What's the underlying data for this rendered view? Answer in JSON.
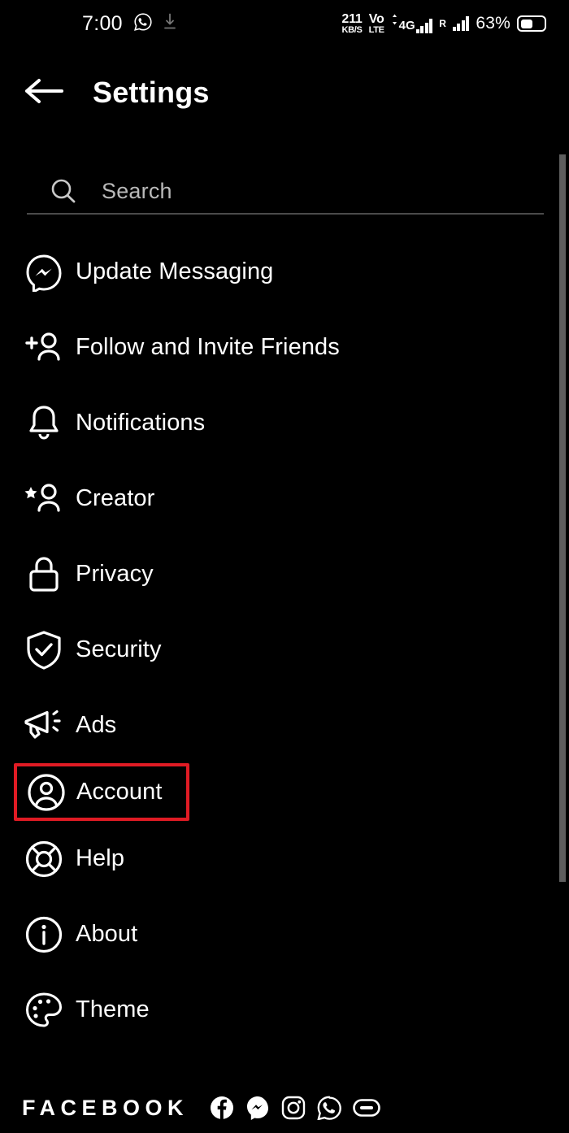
{
  "status_bar": {
    "time": "7:00",
    "whatsapp_icon": "whatsapp-icon",
    "download_icon": "download-icon",
    "net_speed_value": "211",
    "net_speed_unit": "KB/S",
    "volte_top": "Vo",
    "volte_bottom": "LTE",
    "network_type": "4G",
    "roaming_label": "R",
    "battery_percent": "63%"
  },
  "header": {
    "back_icon": "back-arrow-icon",
    "title": "Settings"
  },
  "search": {
    "icon": "search-icon",
    "placeholder": "Search",
    "value": ""
  },
  "settings": {
    "items": [
      {
        "icon": "messenger-icon",
        "label": "Update Messaging",
        "highlighted": false
      },
      {
        "icon": "add-person-icon",
        "label": "Follow and Invite Friends",
        "highlighted": false
      },
      {
        "icon": "bell-icon",
        "label": "Notifications",
        "highlighted": false
      },
      {
        "icon": "star-person-icon",
        "label": "Creator",
        "highlighted": false
      },
      {
        "icon": "lock-icon",
        "label": "Privacy",
        "highlighted": false
      },
      {
        "icon": "shield-check-icon",
        "label": "Security",
        "highlighted": false
      },
      {
        "icon": "megaphone-icon",
        "label": "Ads",
        "highlighted": false
      },
      {
        "icon": "account-circle-icon",
        "label": "Account",
        "highlighted": true
      },
      {
        "icon": "lifebuoy-icon",
        "label": "Help",
        "highlighted": false
      },
      {
        "icon": "info-circle-icon",
        "label": "About",
        "highlighted": false
      },
      {
        "icon": "palette-icon",
        "label": "Theme",
        "highlighted": false
      }
    ]
  },
  "footer": {
    "wordmark": "FACEBOOK",
    "icons": [
      "facebook-icon",
      "messenger-icon",
      "instagram-icon",
      "whatsapp-icon",
      "portal-icon"
    ]
  },
  "colors": {
    "background": "#000000",
    "text": "#ffffff",
    "muted": "#b9b9b9",
    "highlight": "#e01b24",
    "scrollbar": "#5e5e5e",
    "divider": "#4a4a4a"
  },
  "scrollbar": {
    "name": "vertical-scrollbar"
  }
}
